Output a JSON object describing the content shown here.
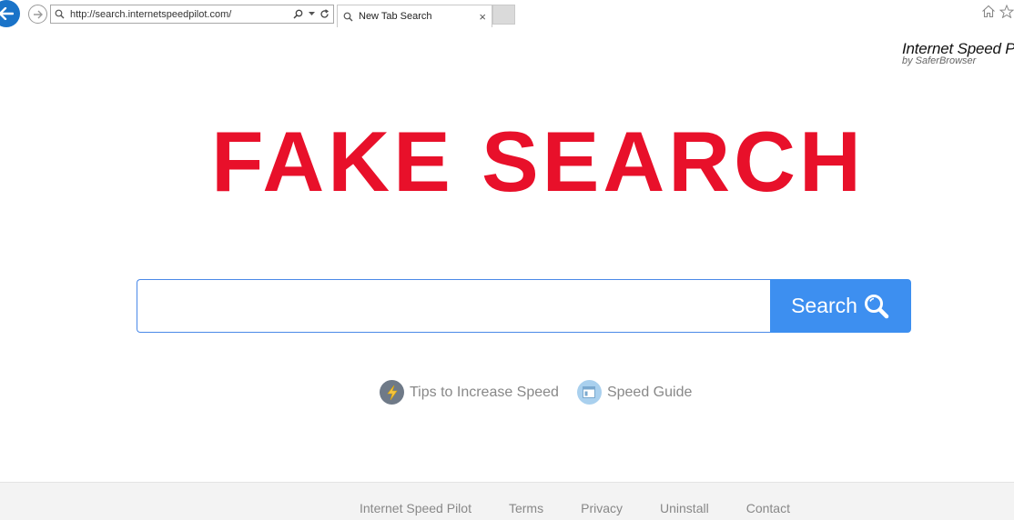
{
  "browser": {
    "address": "http://search.internetspeedpilot.com/",
    "tab_title": "New Tab Search",
    "tab_close": "×"
  },
  "brand": {
    "title": "Internet Speed P",
    "subtitle": "by SaferBrowser"
  },
  "headline": "FAKE SEARCH",
  "search": {
    "placeholder": "",
    "button_label": "Search"
  },
  "quick_links": [
    {
      "label": "Tips to Increase Speed",
      "icon": "lightning-icon"
    },
    {
      "label": "Speed Guide",
      "icon": "guide-icon"
    }
  ],
  "footer": {
    "links": [
      "Internet Speed Pilot",
      "Terms",
      "Privacy",
      "Uninstall",
      "Contact"
    ]
  },
  "colors": {
    "headline": "#e8102a",
    "search_button": "#3d8ff0",
    "back_button": "#1a73c8"
  }
}
